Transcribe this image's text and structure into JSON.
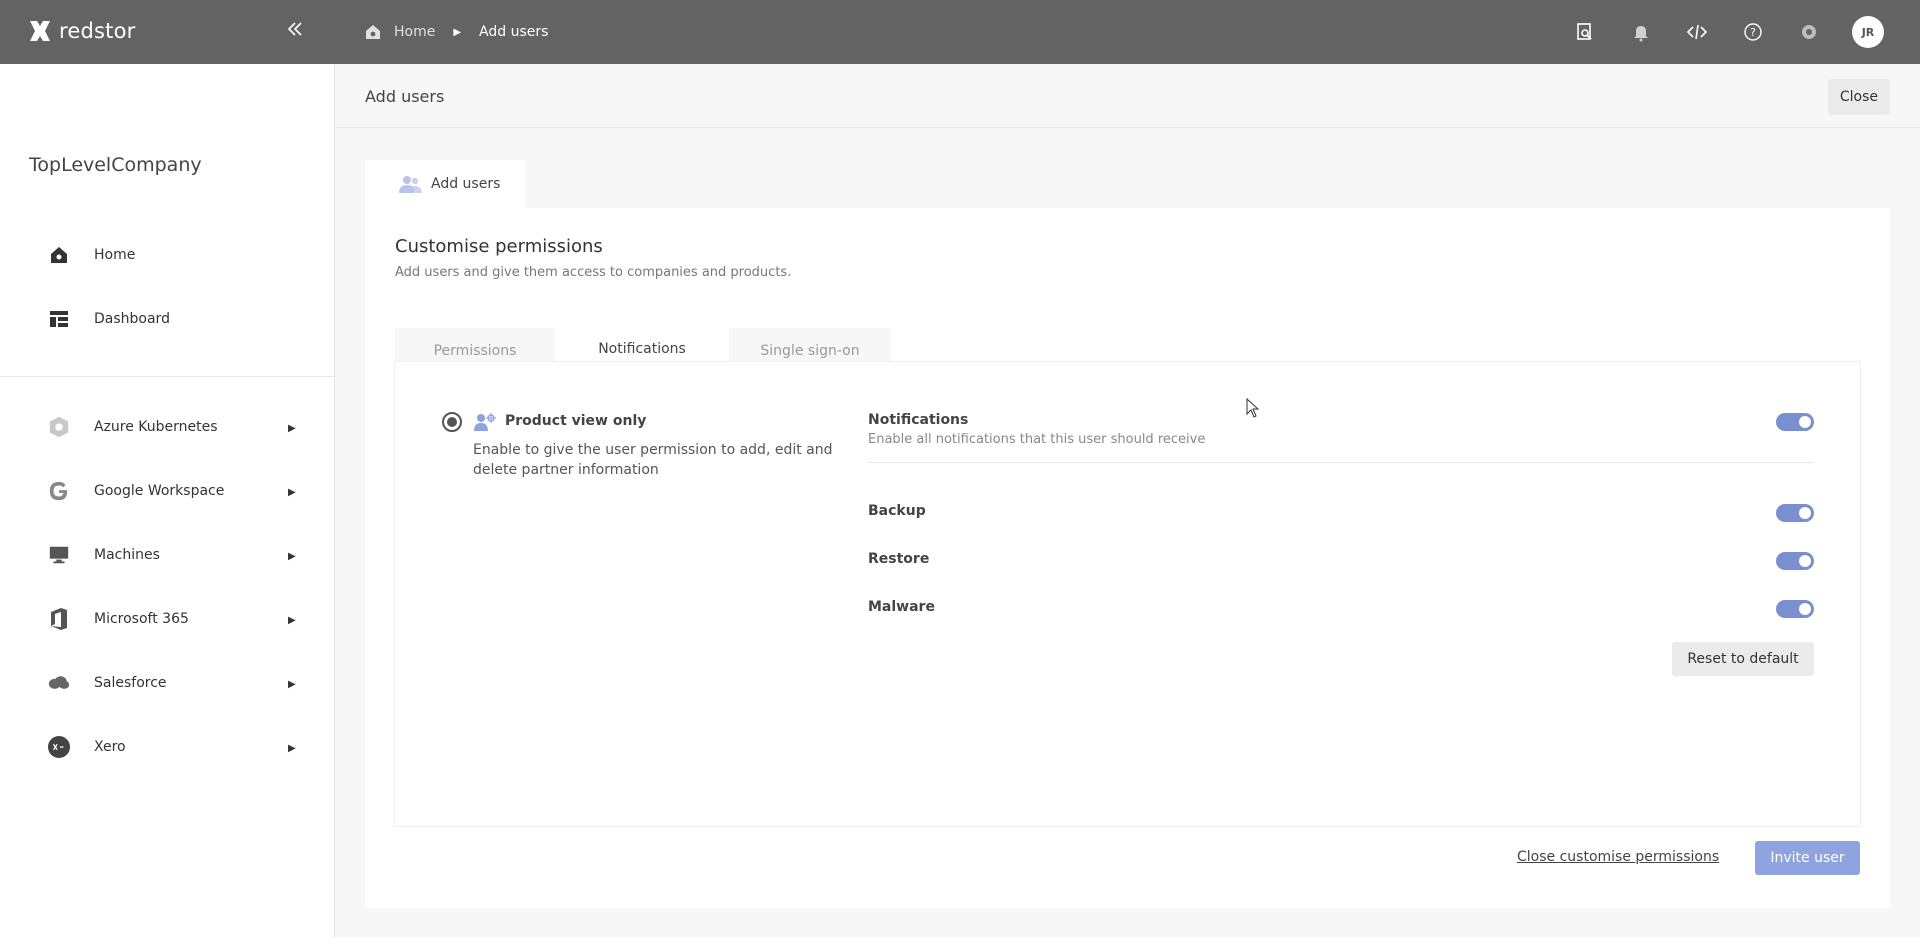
{
  "app": {
    "logo_text": "redstor"
  },
  "breadcrumb": {
    "home": "Home",
    "current": "Add users"
  },
  "user": {
    "initials": "JR"
  },
  "sidebar": {
    "company": "TopLevelCompany",
    "primary": [
      {
        "label": "Home",
        "icon": "home-icon"
      },
      {
        "label": "Dashboard",
        "icon": "dashboard-icon"
      }
    ],
    "products": [
      {
        "label": "Azure Kubernetes",
        "icon": "kubernetes-icon"
      },
      {
        "label": "Google Workspace",
        "icon": "google-icon"
      },
      {
        "label": "Machines",
        "icon": "monitor-icon"
      },
      {
        "label": "Microsoft 365",
        "icon": "office-icon"
      },
      {
        "label": "Salesforce",
        "icon": "salesforce-icon"
      },
      {
        "label": "Xero",
        "icon": "xero-icon"
      }
    ]
  },
  "header": {
    "title": "Add users",
    "close_label": "Close"
  },
  "outer_tab": {
    "label": "Add users"
  },
  "customise": {
    "title": "Customise permissions",
    "subtitle": "Add users and give them access to companies and products.",
    "tabs": [
      {
        "label": "Permissions",
        "active": false
      },
      {
        "label": "Notifications",
        "active": true
      },
      {
        "label": "Single sign-on",
        "active": false
      }
    ],
    "role": {
      "title": "Product view only",
      "description": "Enable to give the user permission to add, edit and delete partner information",
      "selected": true
    },
    "notifications": {
      "title": "Notifications",
      "description": "Enable all notifications that this user should receive",
      "enabled": true,
      "items": [
        {
          "label": "Backup",
          "enabled": true
        },
        {
          "label": "Restore",
          "enabled": true
        },
        {
          "label": "Malware",
          "enabled": true
        }
      ],
      "reset_label": "Reset to default"
    },
    "close_link": "Close customise permissions",
    "invite_label": "Invite user"
  },
  "colors": {
    "topbar": "#636363",
    "accent": "#7a8fd0",
    "invite": "#8fa3de"
  }
}
